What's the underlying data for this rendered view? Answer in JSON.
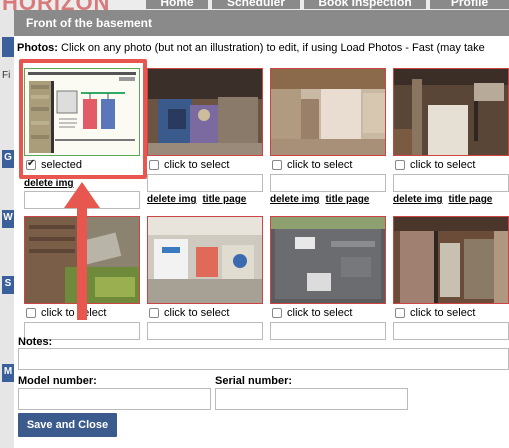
{
  "background": {
    "logo": "HORIZON",
    "nav_tabs": [
      "Home",
      "Scheduler",
      "Book Inspection",
      "Profile"
    ],
    "side_letters": [
      "G",
      "W",
      "S",
      "M"
    ],
    "fi_text": "Fi"
  },
  "modal": {
    "title": "Front of the basement",
    "photos_label": "Photos:",
    "photos_hint": " Click on any photo (but not an illustration) to edit, if using Load Photos - Fast (may take"
  },
  "photos": [
    {
      "checkbox_label": "selected",
      "checked": true,
      "links": [
        "delete img"
      ]
    },
    {
      "checkbox_label": "click to select",
      "checked": false,
      "links": [
        "delete img",
        "title page"
      ]
    },
    {
      "checkbox_label": "click to select",
      "checked": false,
      "links": [
        "delete img",
        "title page"
      ]
    },
    {
      "checkbox_label": "click to select",
      "checked": false,
      "links": [
        "delete img",
        "title page"
      ]
    },
    {
      "checkbox_label": "click to select",
      "checked": false,
      "links": []
    },
    {
      "checkbox_label": "click to select",
      "checked": false,
      "links": []
    },
    {
      "checkbox_label": "click to select",
      "checked": false,
      "links": []
    },
    {
      "checkbox_label": "click to select",
      "checked": false,
      "links": []
    }
  ],
  "form": {
    "notes_label": "Notes:",
    "model_label": "Model number:",
    "serial_label": "Serial number:",
    "save_label": "Save and Close"
  },
  "colors": {
    "header_bg": "#8a8a8a",
    "thumb_border": "#cc4444",
    "highlight": "#e8574f",
    "button_bg": "#3b5b8c"
  }
}
